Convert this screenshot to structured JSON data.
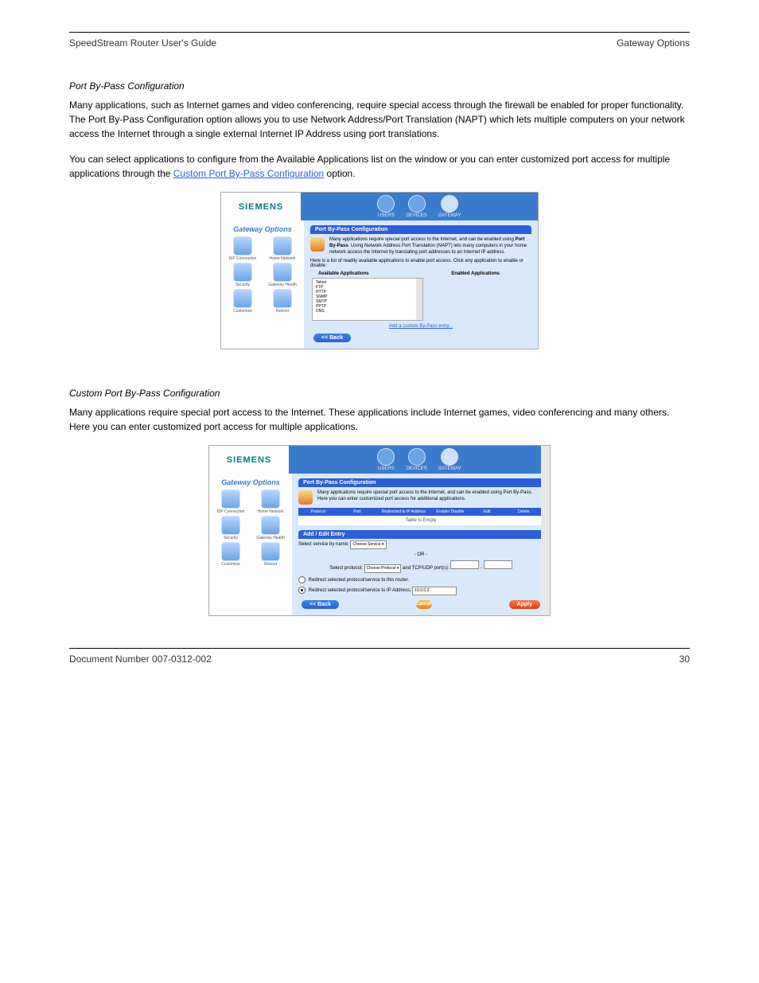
{
  "header": {
    "left": "SpeedStream Router User's Guide",
    "right": "Gateway Options"
  },
  "s1": {
    "title": "Port By-Pass Configuration",
    "p1": "Many applications, such as Internet games and video conferencing, require special access through the firewall be enabled for proper functionality. The Port By-Pass Configuration option allows you to use Network Address/Port Translation (NAPT) which lets multiple computers on your network access the Internet through a single external Internet IP Address using port translations.",
    "p2a": "You can select applications to configure from the Available Applications list on the window or you can enter customized port access for multiple applications through the ",
    "p2link": "Custom Port By-Pass Configuration",
    "p2b": " option."
  },
  "fig1": {
    "logo": "SIEMENS",
    "tabs": [
      "USERS",
      "DEVICES",
      "GATEWAY"
    ],
    "sideTitle": "Gateway Options",
    "sideItems": [
      "ISP Connection",
      "Home Network",
      "Security",
      "Gateway Health",
      "Customize",
      "Reboot"
    ],
    "bar": "Port By-Pass Configuration",
    "introA": "Many applications require special port access to the Internet, and can be enabled using ",
    "introBold": "Port By-Pass",
    "introB": ". Using Network Address Port Translation (NAPT) lets many computers in your home network access the Internet by translating port addresses to an Internet IP address.",
    "listLine": "Here is a list of readily available applications to enable port access. Click any application to enable or disable:",
    "avail": "Available Applications",
    "enabled": "Enabled Applications",
    "apps": [
      "Telnet",
      "FTP",
      "HTTP",
      "SNMP",
      "SMTP",
      "PPTP",
      "DNS"
    ],
    "customLink": "Add a custom By-Pass entry...",
    "back": "<< Back"
  },
  "s2": {
    "title": "Custom Port By-Pass Configuration",
    "p1": "Many applications require special port access to the Internet. These applications include Internet games, video conferencing and many others. Here you can enter customized port access for multiple applications."
  },
  "fig2": {
    "logo": "SIEMENS",
    "tabs": [
      "USERS",
      "DEVICES",
      "GATEWAY"
    ],
    "sideTitle": "Gateway Options",
    "sideItems": [
      "ISP Connection",
      "Home Network",
      "Security",
      "Gateway Health",
      "Customize",
      "Reboot"
    ],
    "bar": "Port By-Pass Configuration",
    "intro": "Many applications require special port access to the Internet, and can be enabled using Port By-Pass. Here you can enter customized port access for additional applications.",
    "cols": [
      "Protocol",
      "Port",
      "Redirected to IP Address",
      "Enable/ Disable",
      "Edit",
      "Delete"
    ],
    "empty": "Table is Empty",
    "addBar": "Add / Edit Entry",
    "svcLabel": "Select service by name:",
    "svcSel": "Choose Service",
    "or": "- OR -",
    "protLabel": "Select protocol:",
    "protSel": "Choose Protocol",
    "portsLabel": "and TCP/UDP port(s):",
    "dash": "-",
    "radio1": "Redirect selected protocol/service to this router.",
    "radio2": "Redirect selected protocol/service to IP Address:",
    "ip": "10.0.0.2",
    "back": "<< Back",
    "cancel": "Cancel",
    "apply": "Apply"
  },
  "footer": {
    "left": "Document Number 007-0312-002",
    "right": "30"
  }
}
